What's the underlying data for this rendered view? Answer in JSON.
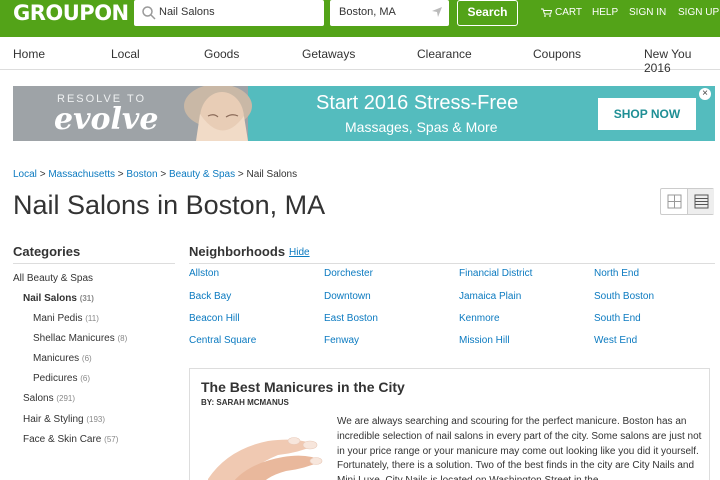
{
  "header": {
    "logo": "GROUPON",
    "search_value": "Nail Salons",
    "location_value": "Boston, MA",
    "search_button": "Search",
    "links": {
      "cart": "CART",
      "help": "HELP",
      "sign_in": "SIGN IN",
      "sign_up": "SIGN UP"
    },
    "brand_color": "#53a318"
  },
  "nav": {
    "items": [
      "Home",
      "Local",
      "Goods",
      "Getaways",
      "Clearance",
      "Coupons",
      "New You 2016"
    ]
  },
  "banner": {
    "resolve_to": "RESOLVE TO",
    "evolve": "evolve",
    "headline": "Start 2016 Stress-Free",
    "subhead": "Massages, Spas & More",
    "cta": "SHOP NOW",
    "close": "×",
    "accent_color": "#54bcbe"
  },
  "breadcrumb": {
    "items": [
      "Local",
      "Massachusetts",
      "Boston",
      "Beauty & Spas"
    ],
    "current": "Nail Salons",
    "separator": ">"
  },
  "page_title": "Nail Salons in Boston, MA",
  "categories": {
    "heading": "Categories",
    "items": [
      {
        "label": "All Beauty & Spas",
        "count": ""
      },
      {
        "label": "Nail Salons",
        "count": "(31)"
      },
      {
        "label": "Mani Pedis",
        "count": "(11)"
      },
      {
        "label": "Shellac Manicures",
        "count": "(8)"
      },
      {
        "label": "Manicures",
        "count": "(6)"
      },
      {
        "label": "Pedicures",
        "count": "(6)"
      },
      {
        "label": "Salons",
        "count": "(291)"
      },
      {
        "label": "Hair & Styling",
        "count": "(193)"
      },
      {
        "label": "Face & Skin Care",
        "count": "(57)"
      }
    ]
  },
  "neighborhoods": {
    "heading": "Neighborhoods",
    "hide": "Hide",
    "items": [
      "Allston",
      "Dorchester",
      "Financial District",
      "North End",
      "Back Bay",
      "Downtown",
      "Jamaica Plain",
      "South Boston",
      "Beacon Hill",
      "East Boston",
      "Kenmore",
      "South End",
      "Central Square",
      "Fenway",
      "Mission Hill",
      "West End"
    ]
  },
  "article": {
    "title": "The Best Manicures in the City",
    "byline": "BY: SARAH MCMANUS",
    "body": "We are always searching and scouring for the perfect manicure. Boston has an incredible selection of nail salons in every part of the city. Some salons are just not in your price range or your manicure may come out looking like you did it yourself. Fortunately, there is a solution. Two of the best finds in the city are City Nails and Mini Luxe. City Nails is located on Washington Street in the"
  }
}
